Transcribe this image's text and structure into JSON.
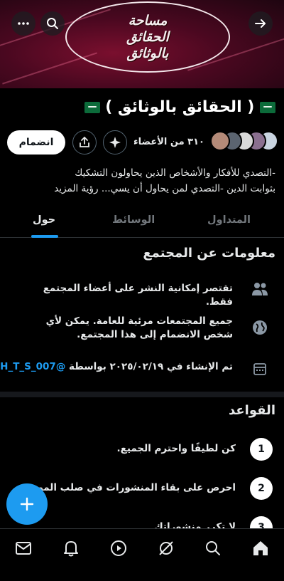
{
  "banner": {
    "line1": "مساحة",
    "line2": "الحقائق",
    "line3": "بالوثائق"
  },
  "header": {
    "title": "( الحقائق بالوثائق )",
    "join_label": "انضمام",
    "members_text": "٣١٠ من الأعضاء"
  },
  "description": {
    "line1": "-التصدي للأفكار والأشخاص الذين يحاولون التشكيك",
    "line2": "بثوابت الدين -التصدي لمن يحاول أن يسي...",
    "see_more": "رؤية المزيد"
  },
  "tabs": [
    {
      "label": "المتداول",
      "active": false
    },
    {
      "label": "الوسائط",
      "active": false
    },
    {
      "label": "حول",
      "active": true
    }
  ],
  "info": {
    "title": "معلومات عن المجتمع",
    "posting": "تقتصر إمكانية النشر على أعضاء المجتمع فقط.",
    "visibility_line1": "جميع المجتمعات مرئية للعامة. يمكن لأي",
    "visibility_line2": "شخص الانضمام إلى هذا المجتمع.",
    "created_text": "تم الإنشاء في ٢٠٢٥/٠٢/١٩ بواسطة",
    "created_handle": "@H_T_S_007"
  },
  "rules": {
    "title": "القواعد",
    "items": [
      {
        "num": "1",
        "text": "كن لطيفًا واحترم الجميع."
      },
      {
        "num": "2",
        "text": "احرص على بقاء المنشورات في صلب الموضوع."
      },
      {
        "num": "3",
        "text": "لا تكرر منشوراتك"
      }
    ]
  },
  "icons": {
    "back": "arrow-right-icon",
    "search": "search-icon",
    "more": "more-icon",
    "share": "share-icon",
    "sparkle": "sparkle-icon",
    "compose": "plus-icon"
  },
  "colors": {
    "accent": "#1d9bf0",
    "background": "#000000",
    "banner": "#5a0a26"
  }
}
